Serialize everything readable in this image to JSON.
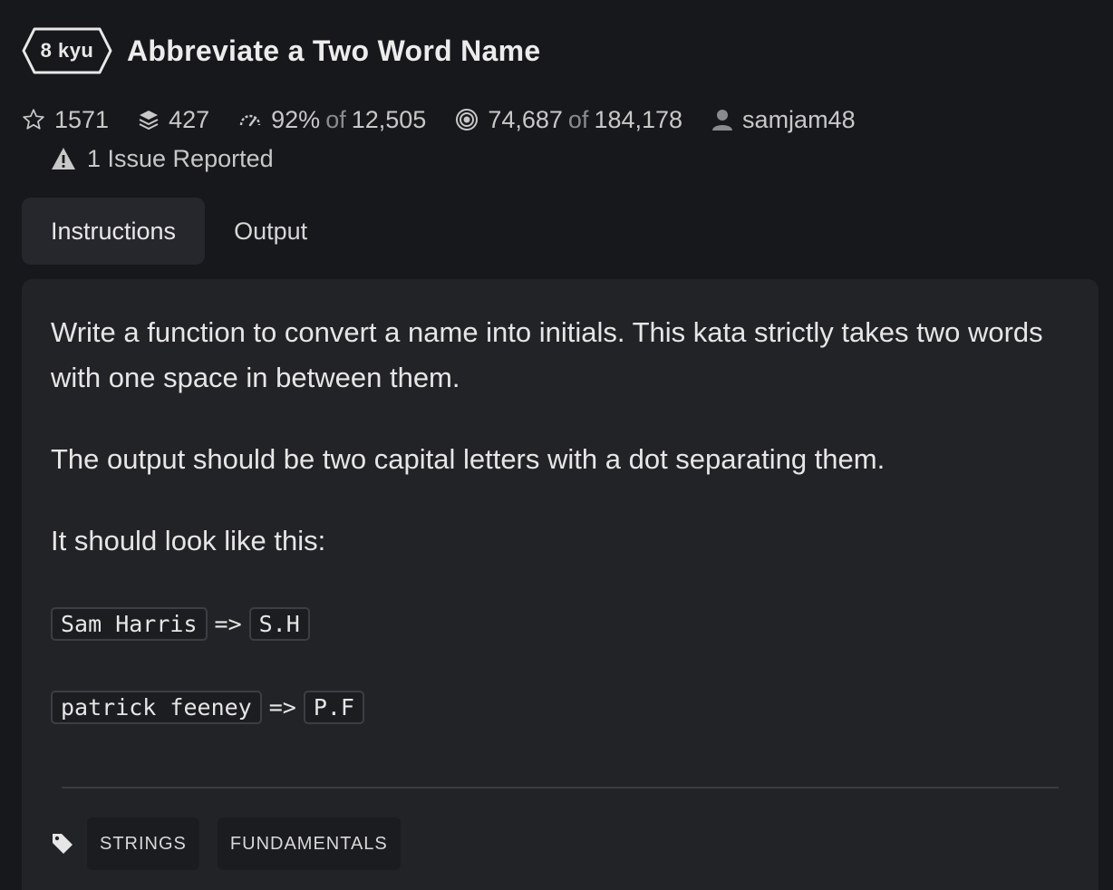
{
  "kata": {
    "rank": "8 kyu",
    "title": "Abbreviate a Two Word Name"
  },
  "stats": {
    "stars": "1571",
    "collections": "427",
    "satisfaction": "92%",
    "satisfaction_of_label": "of",
    "satisfaction_votes": "12,505",
    "completed": "74,687",
    "completed_of_label": "of",
    "attempted": "184,178",
    "author": "samjam48",
    "issues": "1 Issue Reported"
  },
  "tabs": [
    {
      "label": "Instructions",
      "active": true
    },
    {
      "label": "Output",
      "active": false
    }
  ],
  "instructions": {
    "paragraph1": "Write a function to convert a name into initials. This kata strictly takes two words with one space in between them.",
    "paragraph2": "The output should be two capital letters with a dot separating them.",
    "paragraph3": "It should look like this:",
    "examples": [
      {
        "input": "Sam Harris",
        "arrow": "=>",
        "output": "S.H"
      },
      {
        "input": "patrick feeney",
        "arrow": "=>",
        "output": "P.F"
      }
    ]
  },
  "tags": [
    "STRINGS",
    "FUNDAMENTALS"
  ],
  "icons": {
    "star": "star-icon",
    "collections": "layers-icon",
    "satisfaction": "gauge-icon",
    "completed": "target-icon",
    "author": "user-icon",
    "issues": "warning-icon",
    "tags": "tag-icon"
  }
}
